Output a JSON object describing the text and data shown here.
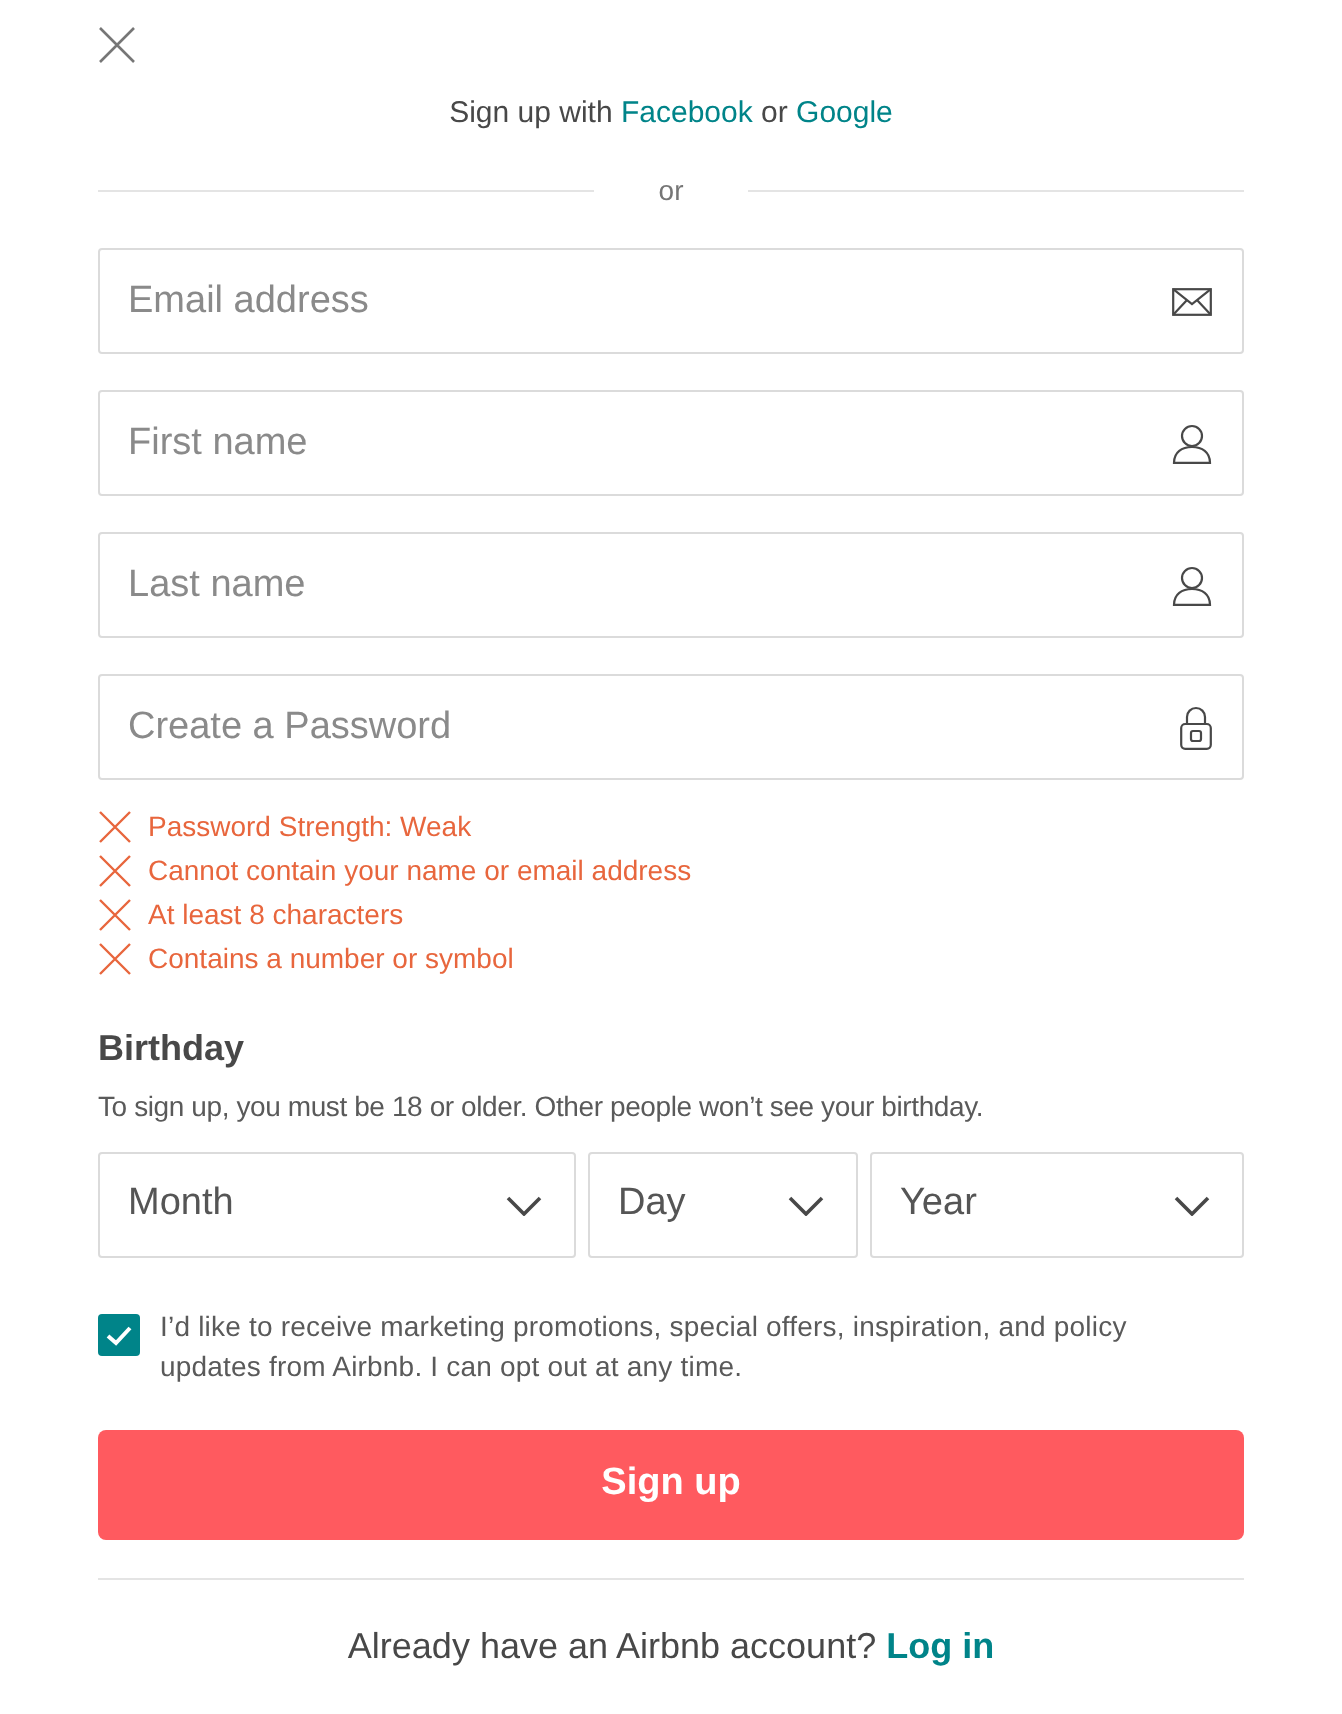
{
  "social": {
    "prefix": "Sign up with",
    "first_link": "Facebook",
    "joiner": "or",
    "second_link": "Google"
  },
  "divider_text": "or",
  "fields": [
    {
      "placeholder": "Email address",
      "kind": "email"
    },
    {
      "placeholder": "First name",
      "kind": "person"
    },
    {
      "placeholder": "Last name",
      "kind": "person"
    },
    {
      "placeholder": "Create a Password",
      "kind": "password"
    }
  ],
  "password_errors": [
    "Password Strength: Weak",
    "Cannot contain your name or email address",
    "At least 8 characters",
    "Contains a number or symbol"
  ],
  "birthday": {
    "heading": "Birthday",
    "note": "To sign up, you must be 18 or older. Other people won’t see your birthday.",
    "selects": [
      {
        "label": "Month",
        "kind": "wide"
      },
      {
        "label": "Day",
        "kind": "narrow"
      },
      {
        "label": "Year",
        "kind": "medium"
      }
    ]
  },
  "marketing": {
    "checked": true,
    "text": "I’d like to receive marketing promotions, special offers, inspiration, and policy updates from Airbnb. I can opt out at any time."
  },
  "submit": "Sign up",
  "login": {
    "question": "Already have an Airbnb account?",
    "link": "Log in"
  }
}
